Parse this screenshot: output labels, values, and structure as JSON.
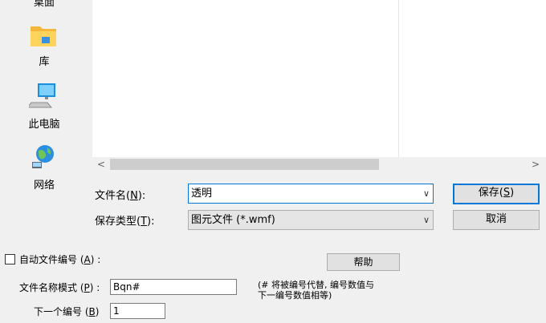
{
  "nav": {
    "items": [
      {
        "label": "桌面",
        "icon": "desktop-icon"
      },
      {
        "label": "库",
        "icon": "library-folder-icon"
      },
      {
        "label": "此电脑",
        "icon": "computer-icon"
      },
      {
        "label": "网络",
        "icon": "network-globe-icon"
      }
    ]
  },
  "filename": {
    "label_text": "文件名(",
    "label_key": "N",
    "label_tail": "):",
    "value": "透明"
  },
  "filetype": {
    "label_text": "保存类型(",
    "label_key": "T",
    "label_tail": "):",
    "value": "图元文件 (*.wmf)"
  },
  "buttons": {
    "save_text": "保存(",
    "save_key": "S",
    "save_tail": ")",
    "cancel": "取消",
    "help": "帮助"
  },
  "auto_number": {
    "label_text": "自动文件编号 (",
    "label_key": "A",
    "label_tail": ") :",
    "checked": false
  },
  "pattern": {
    "label_text": "文件名称模式 (",
    "label_key": "P",
    "label_tail": ") :",
    "value": "Bqn#",
    "hint_line1": "(# 将被编号代替, 编号数值与",
    "hint_line2": "下一编号数值相等)"
  },
  "next_number": {
    "label_text": "下一个编号 (",
    "label_key": "B",
    "label_tail": ")",
    "value": "1"
  },
  "scrollbar": {
    "left_arrow": "<",
    "right_arrow": ">"
  }
}
